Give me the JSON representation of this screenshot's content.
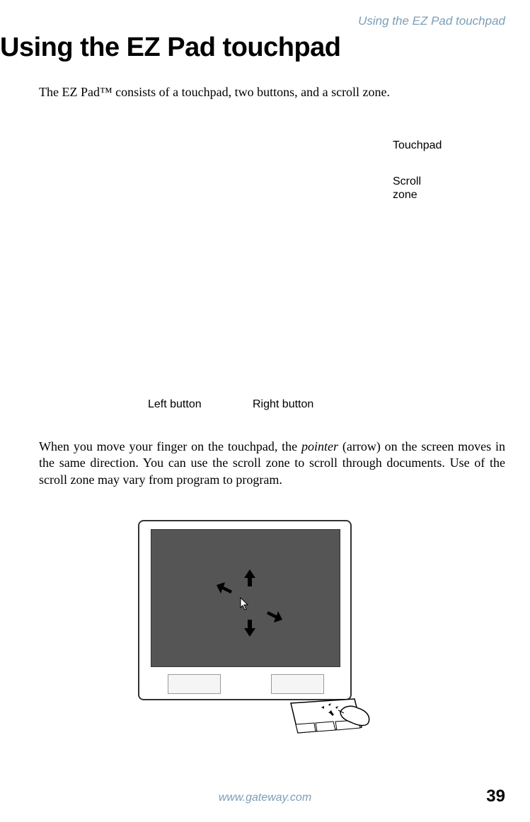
{
  "header": {
    "section_title": "Using the EZ Pad touchpad"
  },
  "heading": "Using the EZ Pad touchpad",
  "intro": "The EZ Pad™ consists of a touchpad, two buttons, and a scroll zone.",
  "labels": {
    "touchpad": "Touchpad",
    "scroll_line1": "Scroll",
    "scroll_line2": "zone",
    "left_button": "Left button",
    "right_button": "Right button"
  },
  "body_paragraph": {
    "part1": "When you move your finger on the touchpad, the ",
    "italic": "pointer",
    "part2": " (arrow) on the screen moves in the same direction. You can use the scroll zone to scroll through documents. Use of the scroll zone may vary from program to program."
  },
  "footer": {
    "url": "www.gateway.com",
    "page_number": "39"
  }
}
